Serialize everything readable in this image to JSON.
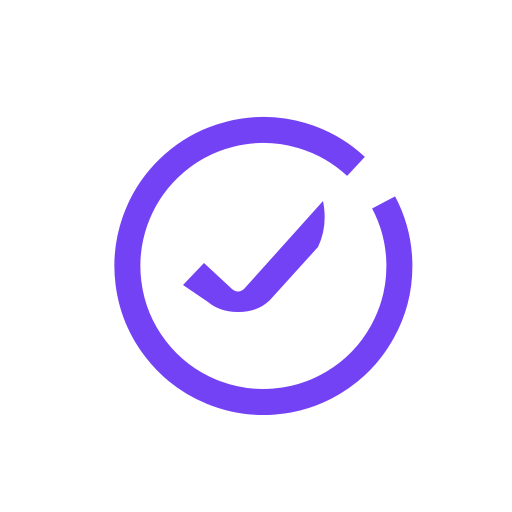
{
  "logo": {
    "icon": "circle-check-icon",
    "color": "#7442F5",
    "background": "#FFFFFF"
  }
}
